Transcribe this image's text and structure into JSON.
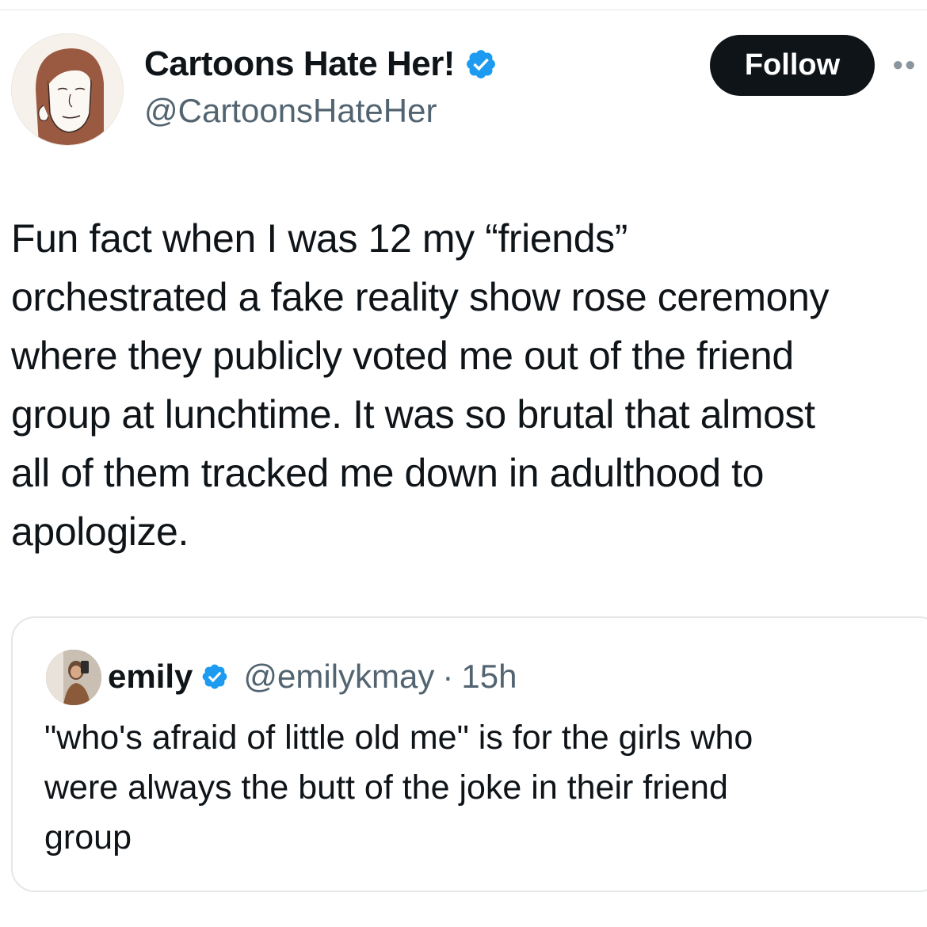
{
  "author": {
    "display_name": "Cartoons Hate Her!",
    "handle": "@CartoonsHateHer",
    "avatar_icon": "cartoon-woman-avatar"
  },
  "follow_label": "Follow",
  "more_icon": "more-dots-icon",
  "tweet": {
    "lines": [
      "Fun fact when I was 12 my “friends”",
      "orchestrated a fake reality show rose ceremony",
      "where they publicly voted me out of the friend",
      "group at lunchtime. It was so brutal that almost",
      "all of them tracked me down in adulthood to",
      "apologize."
    ]
  },
  "quoted": {
    "name": "emily",
    "handle": "@emilykmay",
    "separator": "·",
    "time": "15h",
    "avatar_icon": "photo-avatar",
    "lines": [
      "\"who's afraid of little old me\" is for the girls who",
      "were always the butt of the joke in their friend",
      "group"
    ]
  },
  "colors": {
    "verified_blue": "#1d9bf0",
    "text_primary": "#0f1419",
    "text_secondary": "#536471",
    "button_bg": "#0f1419"
  }
}
